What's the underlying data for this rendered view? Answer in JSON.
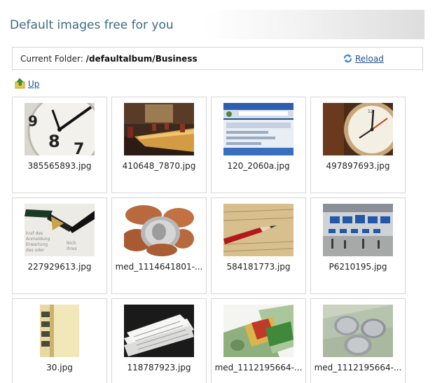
{
  "header": {
    "title": "Default images free for you"
  },
  "folder": {
    "label": "Current Folder:",
    "path": "/defaultalbum/Business",
    "reload_label": "Reload"
  },
  "nav": {
    "up_label": "Up"
  },
  "images": [
    {
      "name": "385565893.jpg",
      "thumb": "clock-closeup"
    },
    {
      "name": "410648_7870.jpg",
      "thumb": "conference-room"
    },
    {
      "name": "120_2060a.jpg",
      "thumb": "browser-screen"
    },
    {
      "name": "497897693.jpg",
      "thumb": "clock-wood"
    },
    {
      "name": "227929613.jpg",
      "thumb": "fountain-pen"
    },
    {
      "name": "med_1114641801-...",
      "thumb": "coins"
    },
    {
      "name": "584181773.jpg",
      "thumb": "red-pen"
    },
    {
      "name": "P6210195.jpg",
      "thumb": "airport-hall"
    },
    {
      "name": "30.jpg",
      "thumb": "binders"
    },
    {
      "name": "118787923.jpg",
      "thumb": "newspapers"
    },
    {
      "name": "med_1112195664-...",
      "thumb": "cash-and-cards"
    },
    {
      "name": "med_1112195664-...",
      "thumb": "coins-on-dollars"
    }
  ]
}
